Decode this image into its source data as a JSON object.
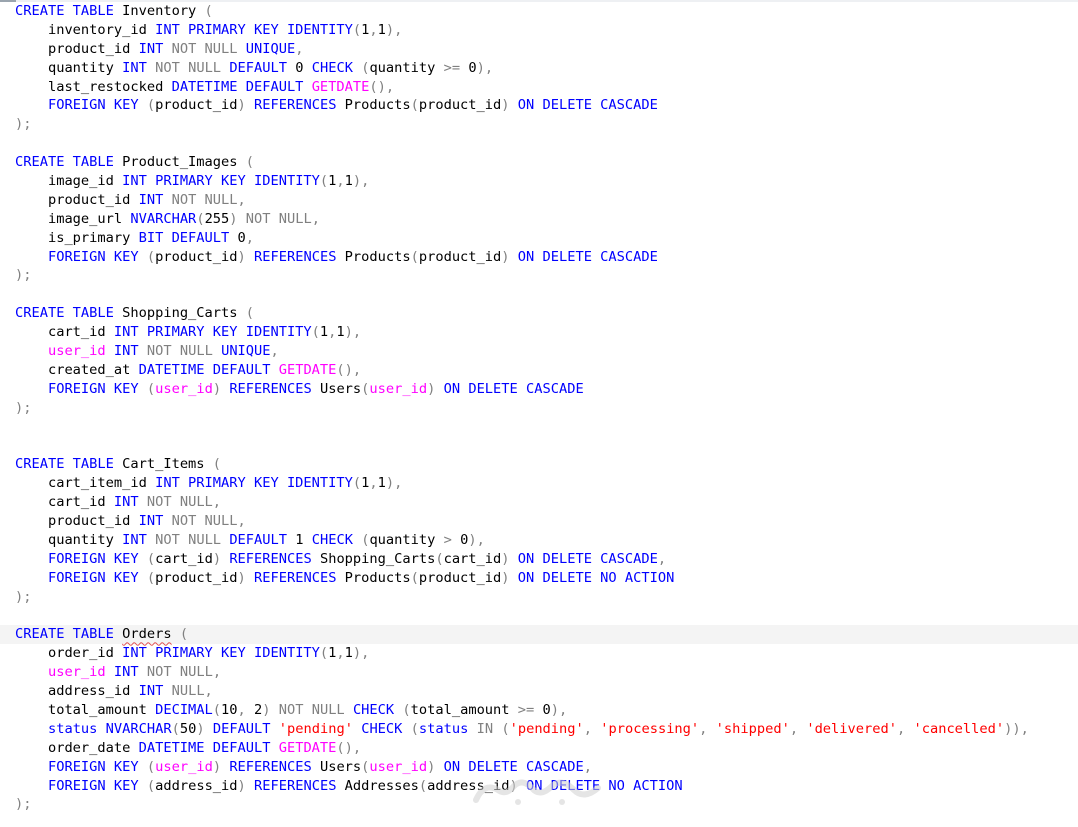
{
  "editor": {
    "language": "sql",
    "current_line": 33,
    "colors": {
      "keyword": "#0000ff",
      "operator": "#808080",
      "function": "#ff00ff",
      "string": "#ff0000",
      "text": "#000000",
      "current_line_bg": "#f4f4f4"
    },
    "lines": [
      [
        [
          "CREATE TABLE",
          "kw"
        ],
        [
          " Inventory ",
          ""
        ],
        [
          "(",
          "gy"
        ]
      ],
      [
        [
          "    inventory_id ",
          ""
        ],
        [
          "INT PRIMARY KEY IDENTITY",
          "kw"
        ],
        [
          "(",
          "gy"
        ],
        [
          "1",
          "num"
        ],
        [
          ",",
          "gy"
        ],
        [
          "1",
          "num"
        ],
        [
          "),",
          "gy"
        ]
      ],
      [
        [
          "    product_id ",
          ""
        ],
        [
          "INT",
          "kw"
        ],
        [
          " ",
          ""
        ],
        [
          "NOT NULL",
          "gy"
        ],
        [
          " ",
          ""
        ],
        [
          "UNIQUE",
          "kw"
        ],
        [
          ",",
          "gy"
        ]
      ],
      [
        [
          "    quantity ",
          ""
        ],
        [
          "INT",
          "kw"
        ],
        [
          " ",
          ""
        ],
        [
          "NOT NULL",
          "gy"
        ],
        [
          " ",
          ""
        ],
        [
          "DEFAULT",
          "kw"
        ],
        [
          " 0 ",
          ""
        ],
        [
          "CHECK",
          "kw"
        ],
        [
          " ",
          ""
        ],
        [
          "(",
          "gy"
        ],
        [
          "quantity ",
          ""
        ],
        [
          ">=",
          "gy"
        ],
        [
          " 0",
          ""
        ],
        [
          "),",
          "gy"
        ]
      ],
      [
        [
          "    last_restocked ",
          ""
        ],
        [
          "DATETIME DEFAULT",
          "kw"
        ],
        [
          " ",
          ""
        ],
        [
          "GETDATE",
          "fn"
        ],
        [
          "(),",
          "gy"
        ]
      ],
      [
        [
          "    ",
          ""
        ],
        [
          "FOREIGN KEY",
          "kw"
        ],
        [
          " ",
          ""
        ],
        [
          "(",
          "gy"
        ],
        [
          "product_id",
          ""
        ],
        [
          ")",
          "gy"
        ],
        [
          " ",
          ""
        ],
        [
          "REFERENCES",
          "kw"
        ],
        [
          " Products",
          ""
        ],
        [
          "(",
          "gy"
        ],
        [
          "product_id",
          ""
        ],
        [
          ")",
          "gy"
        ],
        [
          " ",
          ""
        ],
        [
          "ON DELETE CASCADE",
          "kw"
        ]
      ],
      [
        [
          ");",
          "gy"
        ]
      ],
      [],
      [
        [
          "CREATE TABLE",
          "kw"
        ],
        [
          " Product_Images ",
          ""
        ],
        [
          "(",
          "gy"
        ]
      ],
      [
        [
          "    image_id ",
          ""
        ],
        [
          "INT PRIMARY KEY IDENTITY",
          "kw"
        ],
        [
          "(",
          "gy"
        ],
        [
          "1",
          "num"
        ],
        [
          ",",
          "gy"
        ],
        [
          "1",
          "num"
        ],
        [
          "),",
          "gy"
        ]
      ],
      [
        [
          "    product_id ",
          ""
        ],
        [
          "INT",
          "kw"
        ],
        [
          " ",
          ""
        ],
        [
          "NOT NULL,",
          "gy"
        ]
      ],
      [
        [
          "    image_url ",
          ""
        ],
        [
          "NVARCHAR",
          "kw"
        ],
        [
          "(",
          "gy"
        ],
        [
          "255",
          ""
        ],
        [
          ")",
          "gy"
        ],
        [
          " ",
          ""
        ],
        [
          "NOT NULL,",
          "gy"
        ]
      ],
      [
        [
          "    is_primary ",
          ""
        ],
        [
          "BIT DEFAULT",
          "kw"
        ],
        [
          " 0",
          ""
        ],
        [
          ",",
          "gy"
        ]
      ],
      [
        [
          "    ",
          ""
        ],
        [
          "FOREIGN KEY",
          "kw"
        ],
        [
          " ",
          ""
        ],
        [
          "(",
          "gy"
        ],
        [
          "product_id",
          ""
        ],
        [
          ")",
          "gy"
        ],
        [
          " ",
          ""
        ],
        [
          "REFERENCES",
          "kw"
        ],
        [
          " Products",
          ""
        ],
        [
          "(",
          "gy"
        ],
        [
          "product_id",
          ""
        ],
        [
          ")",
          "gy"
        ],
        [
          " ",
          ""
        ],
        [
          "ON DELETE CASCADE",
          "kw"
        ]
      ],
      [
        [
          ");",
          "gy"
        ]
      ],
      [],
      [
        [
          "CREATE TABLE",
          "kw"
        ],
        [
          " Shopping_Carts ",
          ""
        ],
        [
          "(",
          "gy"
        ]
      ],
      [
        [
          "    cart_id ",
          ""
        ],
        [
          "INT PRIMARY KEY IDENTITY",
          "kw"
        ],
        [
          "(",
          "gy"
        ],
        [
          "1",
          "num"
        ],
        [
          ",",
          "gy"
        ],
        [
          "1",
          "num"
        ],
        [
          "),",
          "gy"
        ]
      ],
      [
        [
          "    ",
          ""
        ],
        [
          "user_id",
          "fn"
        ],
        [
          " ",
          ""
        ],
        [
          "INT",
          "kw"
        ],
        [
          " ",
          ""
        ],
        [
          "NOT NULL",
          "gy"
        ],
        [
          " ",
          ""
        ],
        [
          "UNIQUE",
          "kw"
        ],
        [
          ",",
          "gy"
        ]
      ],
      [
        [
          "    created_at ",
          ""
        ],
        [
          "DATETIME DEFAULT",
          "kw"
        ],
        [
          " ",
          ""
        ],
        [
          "GETDATE",
          "fn"
        ],
        [
          "(),",
          "gy"
        ]
      ],
      [
        [
          "    ",
          ""
        ],
        [
          "FOREIGN KEY",
          "kw"
        ],
        [
          " ",
          ""
        ],
        [
          "(",
          "gy"
        ],
        [
          "user_id",
          "fn"
        ],
        [
          ")",
          "gy"
        ],
        [
          " ",
          ""
        ],
        [
          "REFERENCES",
          "kw"
        ],
        [
          " Users",
          ""
        ],
        [
          "(",
          "gy"
        ],
        [
          "user_id",
          "fn"
        ],
        [
          ")",
          "gy"
        ],
        [
          " ",
          ""
        ],
        [
          "ON DELETE CASCADE",
          "kw"
        ]
      ],
      [
        [
          ");",
          "gy"
        ]
      ],
      [],
      [],
      [
        [
          "CREATE TABLE",
          "kw"
        ],
        [
          " Cart_Items ",
          ""
        ],
        [
          "(",
          "gy"
        ]
      ],
      [
        [
          "    cart_item_id ",
          ""
        ],
        [
          "INT PRIMARY KEY IDENTITY",
          "kw"
        ],
        [
          "(",
          "gy"
        ],
        [
          "1",
          "num"
        ],
        [
          ",",
          "gy"
        ],
        [
          "1",
          "num"
        ],
        [
          "),",
          "gy"
        ]
      ],
      [
        [
          "    cart_id ",
          ""
        ],
        [
          "INT",
          "kw"
        ],
        [
          " ",
          ""
        ],
        [
          "NOT NULL,",
          "gy"
        ]
      ],
      [
        [
          "    product_id ",
          ""
        ],
        [
          "INT",
          "kw"
        ],
        [
          " ",
          ""
        ],
        [
          "NOT NULL,",
          "gy"
        ]
      ],
      [
        [
          "    quantity ",
          ""
        ],
        [
          "INT",
          "kw"
        ],
        [
          " ",
          ""
        ],
        [
          "NOT NULL",
          "gy"
        ],
        [
          " ",
          ""
        ],
        [
          "DEFAULT",
          "kw"
        ],
        [
          " 1 ",
          ""
        ],
        [
          "CHECK",
          "kw"
        ],
        [
          " ",
          ""
        ],
        [
          "(",
          "gy"
        ],
        [
          "quantity ",
          ""
        ],
        [
          ">",
          "gy"
        ],
        [
          " 0",
          ""
        ],
        [
          "),",
          "gy"
        ]
      ],
      [
        [
          "    ",
          ""
        ],
        [
          "FOREIGN KEY",
          "kw"
        ],
        [
          " ",
          ""
        ],
        [
          "(",
          "gy"
        ],
        [
          "cart_id",
          ""
        ],
        [
          ")",
          "gy"
        ],
        [
          " ",
          ""
        ],
        [
          "REFERENCES",
          "kw"
        ],
        [
          " Shopping_Carts",
          ""
        ],
        [
          "(",
          "gy"
        ],
        [
          "cart_id",
          ""
        ],
        [
          ")",
          "gy"
        ],
        [
          " ",
          ""
        ],
        [
          "ON DELETE CASCADE",
          "kw"
        ],
        [
          ",",
          "gy"
        ]
      ],
      [
        [
          "    ",
          ""
        ],
        [
          "FOREIGN KEY",
          "kw"
        ],
        [
          " ",
          ""
        ],
        [
          "(",
          "gy"
        ],
        [
          "product_id",
          ""
        ],
        [
          ")",
          "gy"
        ],
        [
          " ",
          ""
        ],
        [
          "REFERENCES",
          "kw"
        ],
        [
          " Products",
          ""
        ],
        [
          "(",
          "gy"
        ],
        [
          "product_id",
          ""
        ],
        [
          ")",
          "gy"
        ],
        [
          " ",
          ""
        ],
        [
          "ON DELETE NO ACTION",
          "kw"
        ]
      ],
      [
        [
          ");",
          "gy"
        ]
      ],
      [],
      [
        [
          "CREATE TABLE",
          "kw"
        ],
        [
          " ",
          ""
        ],
        [
          "Orders",
          "squiggle"
        ],
        [
          " ",
          ""
        ],
        [
          "(",
          "gy"
        ]
      ],
      [
        [
          "    order_id ",
          ""
        ],
        [
          "INT PRIMARY KEY IDENTITY",
          "kw"
        ],
        [
          "(",
          "gy"
        ],
        [
          "1",
          "num"
        ],
        [
          ",",
          "gy"
        ],
        [
          "1",
          "num"
        ],
        [
          "),",
          "gy"
        ]
      ],
      [
        [
          "    ",
          ""
        ],
        [
          "user_id",
          "fn"
        ],
        [
          " ",
          ""
        ],
        [
          "INT",
          "kw"
        ],
        [
          " ",
          ""
        ],
        [
          "NOT NULL,",
          "gy"
        ]
      ],
      [
        [
          "    address_id ",
          ""
        ],
        [
          "INT",
          "kw"
        ],
        [
          " ",
          ""
        ],
        [
          "NULL,",
          "gy"
        ]
      ],
      [
        [
          "    total_amount ",
          ""
        ],
        [
          "DECIMAL",
          "kw"
        ],
        [
          "(",
          "gy"
        ],
        [
          "10",
          ""
        ],
        [
          ",",
          "gy"
        ],
        [
          " 2",
          ""
        ],
        [
          ")",
          "gy"
        ],
        [
          " ",
          ""
        ],
        [
          "NOT NULL",
          "gy"
        ],
        [
          " ",
          ""
        ],
        [
          "CHECK",
          "kw"
        ],
        [
          " ",
          ""
        ],
        [
          "(",
          "gy"
        ],
        [
          "total_amount ",
          ""
        ],
        [
          ">=",
          "gy"
        ],
        [
          " 0",
          ""
        ],
        [
          "),",
          "gy"
        ]
      ],
      [
        [
          "    ",
          ""
        ],
        [
          "status",
          "kw"
        ],
        [
          " ",
          ""
        ],
        [
          "NVARCHAR",
          "kw"
        ],
        [
          "(",
          "gy"
        ],
        [
          "50",
          ""
        ],
        [
          ")",
          "gy"
        ],
        [
          " ",
          ""
        ],
        [
          "DEFAULT",
          "kw"
        ],
        [
          " ",
          ""
        ],
        [
          "'pending'",
          "str"
        ],
        [
          " ",
          ""
        ],
        [
          "CHECK",
          "kw"
        ],
        [
          " ",
          ""
        ],
        [
          "(",
          "gy"
        ],
        [
          "status",
          "kw"
        ],
        [
          " ",
          ""
        ],
        [
          "IN",
          "gy"
        ],
        [
          " ",
          ""
        ],
        [
          "(",
          "gy"
        ],
        [
          "'pending'",
          "str"
        ],
        [
          ",",
          "gy"
        ],
        [
          " ",
          ""
        ],
        [
          "'processing'",
          "str"
        ],
        [
          ",",
          "gy"
        ],
        [
          " ",
          ""
        ],
        [
          "'shipped'",
          "str"
        ],
        [
          ",",
          "gy"
        ],
        [
          " ",
          ""
        ],
        [
          "'delivered'",
          "str"
        ],
        [
          ",",
          "gy"
        ],
        [
          " ",
          ""
        ],
        [
          "'cancelled'",
          "str"
        ],
        [
          ")),",
          "gy"
        ]
      ],
      [
        [
          "    order_date ",
          ""
        ],
        [
          "DATETIME DEFAULT",
          "kw"
        ],
        [
          " ",
          ""
        ],
        [
          "GETDATE",
          "fn"
        ],
        [
          "(),",
          "gy"
        ]
      ],
      [
        [
          "    ",
          ""
        ],
        [
          "FOREIGN KEY",
          "kw"
        ],
        [
          " ",
          ""
        ],
        [
          "(",
          "gy"
        ],
        [
          "user_id",
          "fn"
        ],
        [
          ")",
          "gy"
        ],
        [
          " ",
          ""
        ],
        [
          "REFERENCES",
          "kw"
        ],
        [
          " Users",
          ""
        ],
        [
          "(",
          "gy"
        ],
        [
          "user_id",
          "fn"
        ],
        [
          ")",
          "gy"
        ],
        [
          " ",
          ""
        ],
        [
          "ON DELETE CASCADE",
          "kw"
        ],
        [
          ",",
          "gy"
        ]
      ],
      [
        [
          "    ",
          ""
        ],
        [
          "FOREIGN KEY",
          "kw"
        ],
        [
          " ",
          ""
        ],
        [
          "(",
          "gy"
        ],
        [
          "address_id",
          ""
        ],
        [
          ")",
          "gy"
        ],
        [
          " ",
          ""
        ],
        [
          "REFERENCES",
          "kw"
        ],
        [
          " Addresses",
          ""
        ],
        [
          "(",
          "gy"
        ],
        [
          "address_id",
          ""
        ],
        [
          ")",
          "gy"
        ],
        [
          " ",
          ""
        ],
        [
          "ON DELETE NO ACTION",
          "kw"
        ]
      ],
      [
        [
          ");",
          "gy"
        ]
      ]
    ]
  }
}
